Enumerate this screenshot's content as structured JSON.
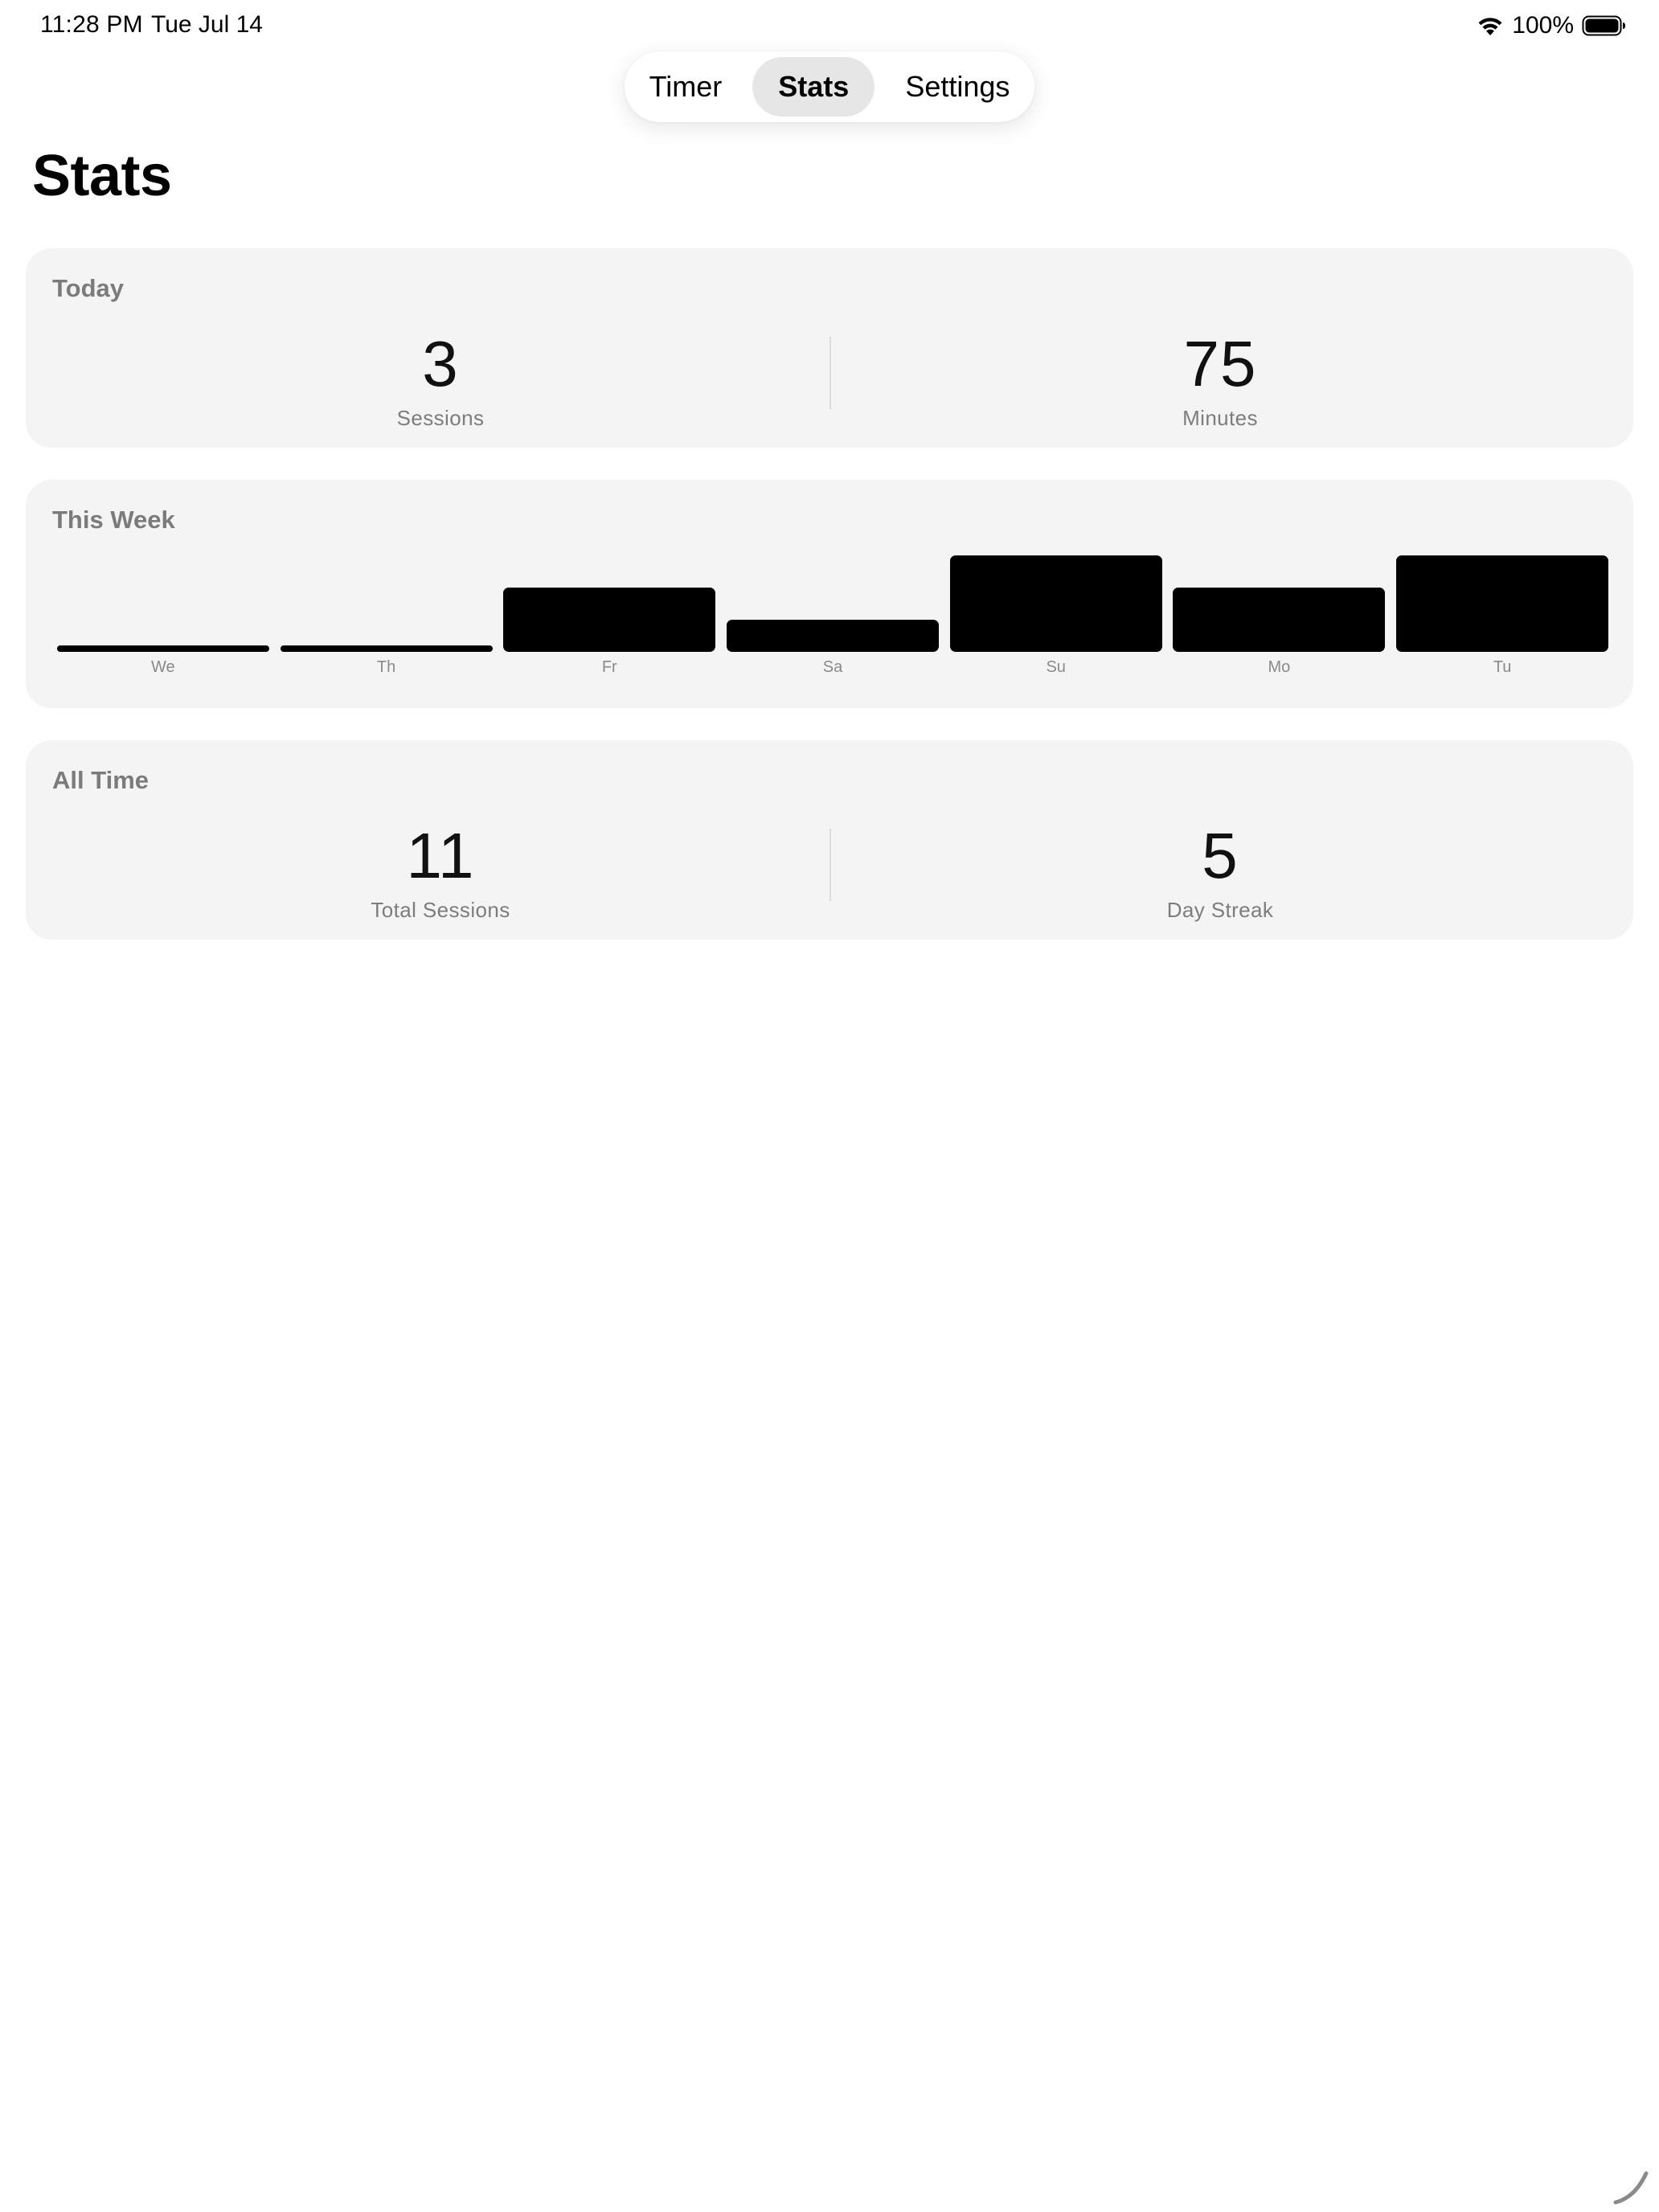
{
  "status_bar": {
    "time": "11:28 PM",
    "date": "Tue Jul 14",
    "battery_percent": "100%",
    "wifi_icon": "wifi-icon",
    "battery_icon": "battery-full-icon"
  },
  "tabs": [
    {
      "label": "Timer",
      "selected": false
    },
    {
      "label": "Stats",
      "selected": true
    },
    {
      "label": "Settings",
      "selected": false
    }
  ],
  "page": {
    "title": "Stats"
  },
  "today": {
    "title": "Today",
    "sessions_value": "3",
    "sessions_label": "Sessions",
    "minutes_value": "75",
    "minutes_label": "Minutes"
  },
  "this_week": {
    "title": "This Week"
  },
  "chart_data": {
    "type": "bar",
    "categories": [
      "We",
      "Th",
      "Fr",
      "Sa",
      "Su",
      "Mo",
      "Tu"
    ],
    "values": [
      0,
      0,
      2,
      1,
      3,
      2,
      3
    ],
    "title": "This Week",
    "xlabel": "",
    "ylabel": "",
    "ylim": [
      0,
      3
    ],
    "grid": false,
    "bar_color": "#000000"
  },
  "all_time": {
    "title": "All Time",
    "total_sessions_value": "11",
    "total_sessions_label": "Total Sessions",
    "streak_value": "5",
    "streak_label": "Day Streak"
  }
}
